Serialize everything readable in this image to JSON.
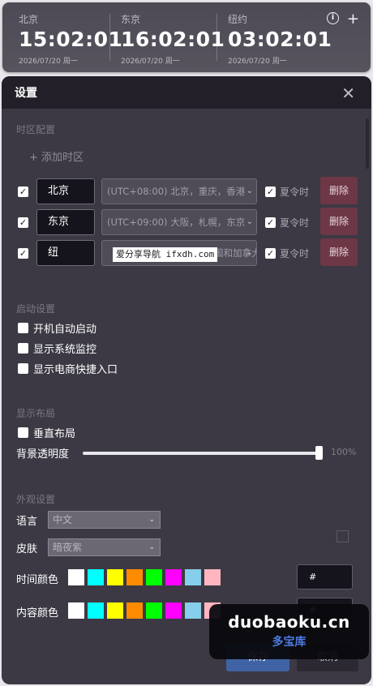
{
  "clocks": [
    {
      "city": "北京",
      "time": "15:02:01",
      "date": "2026/07/20  周一"
    },
    {
      "city": "东京",
      "time": "16:02:01",
      "date": "2026/07/20  周一"
    },
    {
      "city": "纽约",
      "time": "03:02:01",
      "date": "2026/07/20  周一"
    }
  ],
  "widget_icons": {
    "info": "i",
    "add": "+"
  },
  "dialog": {
    "title": "设置",
    "close": "✕",
    "timezone_section": "时区配置",
    "add_timezone": "+ 添加时区",
    "timezones": [
      {
        "checked": true,
        "name": "北京",
        "zone": "(UTC+08:00) 北京，重庆，香港",
        "dst_checked": true,
        "dst_label": "夏令时",
        "delete_label": "删除"
      },
      {
        "checked": true,
        "name": "东京",
        "zone": "(UTC+09:00) 大阪，札幌，东京",
        "dst_checked": true,
        "dst_label": "夏令时",
        "delete_label": "删除"
      },
      {
        "checked": true,
        "name": "纽",
        "zone": "东部时间(美国和加拿大)",
        "dst_checked": true,
        "dst_label": "夏令时",
        "delete_label": "删除"
      }
    ],
    "watermark_text": "爱分享导航 ifxdh.com",
    "startup_section": "启动设置",
    "startup_options": [
      {
        "label": "开机自动启动",
        "checked": false
      },
      {
        "label": "显示系统监控",
        "checked": false
      },
      {
        "label": "显示电商快捷入口",
        "checked": false
      }
    ],
    "layout_section": "显示布局",
    "vertical_layout": {
      "label": "垂直布局",
      "checked": false
    },
    "opacity": {
      "label": "背景透明度",
      "value_text": "100%",
      "percent": 100
    },
    "appearance_section": "外观设置",
    "language": {
      "label": "语言",
      "value": "中文"
    },
    "skin": {
      "label": "皮肤",
      "value": "暗夜紫"
    },
    "time_color": {
      "label": "时间颜色",
      "hex_value": "#"
    },
    "content_color": {
      "label": "内容颜色",
      "hex_value": "#"
    },
    "palette": [
      "#ffffff",
      "#00ffff",
      "#ffff00",
      "#ff8c00",
      "#00ff00",
      "#ff00ff",
      "#87ceeb",
      "#ffb6c1"
    ],
    "save_label": "保存",
    "cancel_label": "取消"
  },
  "brand": {
    "line1": "duobaoku.cn",
    "line2": "多宝库"
  }
}
